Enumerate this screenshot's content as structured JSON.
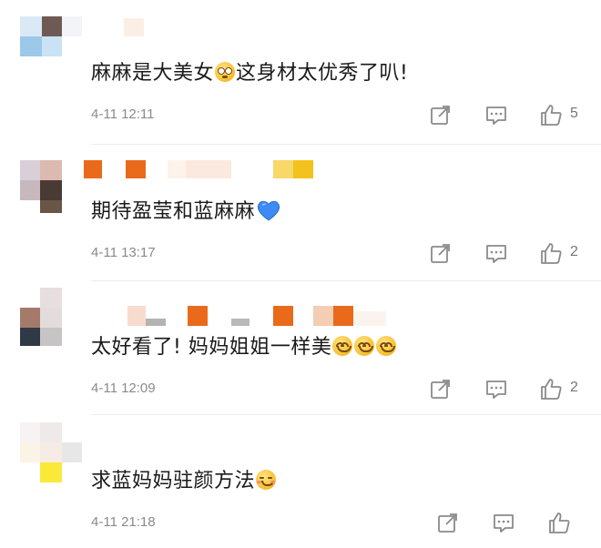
{
  "comments": [
    {
      "text": "麻麻是大美女",
      "text_after": "这身材太优秀了叭!",
      "time": "4-11 12:11",
      "likes": "5",
      "emoji": "tear-icon"
    },
    {
      "text": "期待盈莹和蓝麻麻",
      "time": "4-11 13:17",
      "likes": "2",
      "emoji": "blue-heart-icon"
    },
    {
      "text": "太好看了! 妈妈姐姐一样美",
      "time": "4-11 12:09",
      "likes": "2",
      "emoji": "smile-icon"
    },
    {
      "text": "求蓝妈妈驻颜方法",
      "time": "4-11 21:18",
      "likes": "",
      "emoji": "blush-icon"
    }
  ],
  "colors": {
    "accent_heart": "#3d8bf2",
    "emoji": "#f9c335",
    "meta_text": "#8a8a8a"
  }
}
